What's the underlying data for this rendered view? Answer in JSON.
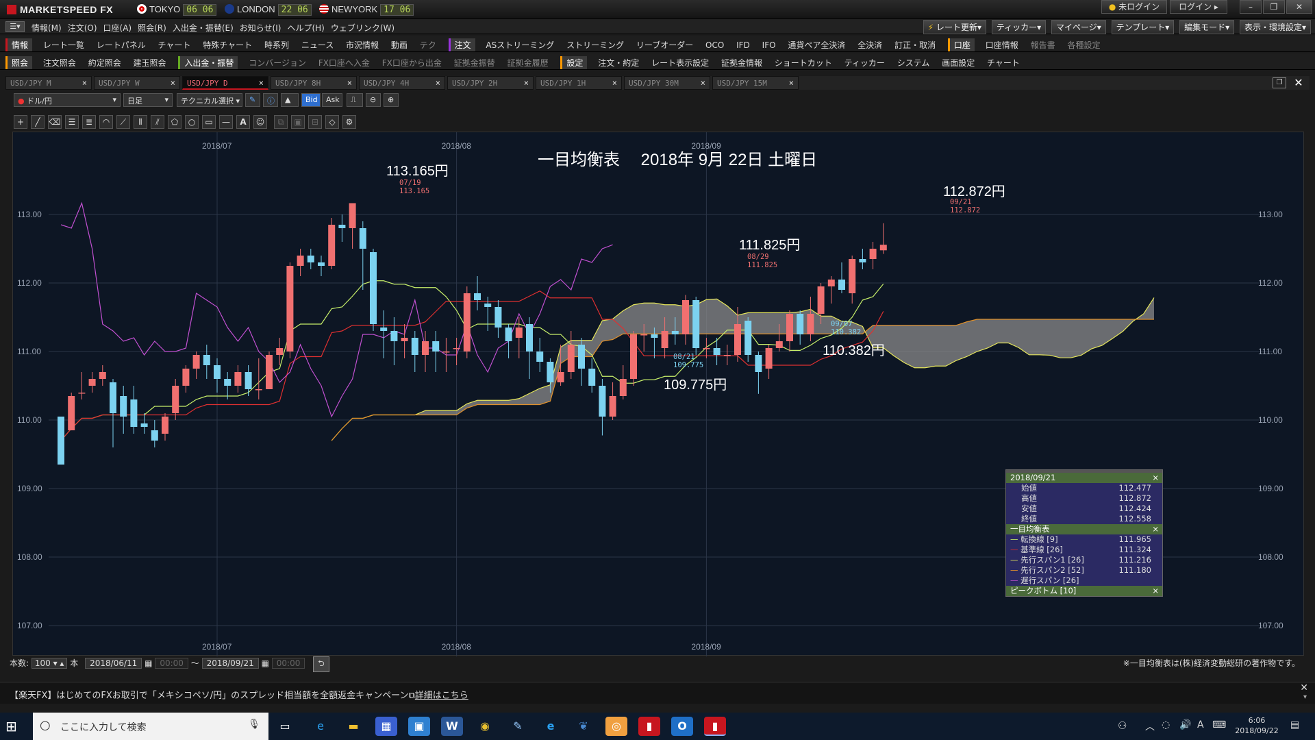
{
  "app": {
    "brand": "MARKETSPEED FX"
  },
  "clocks": [
    {
      "city": "TOKYO",
      "time": "06 06"
    },
    {
      "city": "LONDON",
      "time": "22 06"
    },
    {
      "city": "NEWYORK",
      "time": "17 06"
    }
  ],
  "titlebar_buttons": {
    "status": "未ログイン",
    "login": "ログイン"
  },
  "menu": [
    "情報(M)",
    "注文(O)",
    "口座(A)",
    "照会(R)",
    "入出金・振替(E)",
    "お知らせ(I)",
    "ヘルプ(H)",
    "ウェブリンク(W)"
  ],
  "menu_right": [
    "レート更新",
    "ティッカー",
    "マイページ",
    "テンプレート",
    "編集モード",
    "表示・環境設定"
  ],
  "toolbar1": {
    "info_head": "情報",
    "info_items": [
      "レート一覧",
      "レートパネル",
      "チャート",
      "特殊チャート",
      "時系列",
      "ニュース",
      "市況情報",
      "動画",
      "テク"
    ],
    "order_head": "注文",
    "order_items": [
      "ASストリーミング",
      "ストリーミング",
      "リーブオーダー",
      "OCO",
      "IFD",
      "IFO",
      "通貨ペア全決済",
      "全決済",
      "訂正・取消"
    ],
    "account_head": "口座",
    "account_items": [
      "口座情報",
      "報告書",
      "各種設定"
    ]
  },
  "toolbar2": {
    "inquiry_head": "照会",
    "inquiry_items": [
      "注文照会",
      "約定照会",
      "建玉照会"
    ],
    "deposit_head": "入出金・振替",
    "deposit_items": [
      "コンバージョン",
      "FX口座へ入金",
      "FX口座から出金",
      "証拠金振替",
      "証拠金履歴"
    ],
    "settings_head": "設定",
    "settings_items": [
      "注文・約定",
      "レート表示設定",
      "証拠金情報",
      "ショートカット",
      "ティッカー",
      "システム",
      "画面設定",
      "チャート"
    ]
  },
  "tabs": [
    "USD/JPY M",
    "USD/JPY W",
    "USD/JPY D",
    "USD/JPY 8H",
    "USD/JPY 4H",
    "USD/JPY 2H",
    "USD/JPY 1H",
    "USD/JPY 30M",
    "USD/JPY 15M"
  ],
  "active_tab": 2,
  "chart_controls": {
    "pair": "ドル/円",
    "period": "日足",
    "technical": "テクニカル選択",
    "bid": "Bid",
    "ask": "Ask"
  },
  "chart_title": "一目均衡表　 2018年 9月 22日 土曜日",
  "annotations": {
    "high1_big": "113.165円",
    "high1_date": "07/19",
    "high1_val": "113.165",
    "high2_big": "112.872円",
    "high2_date": "09/21",
    "high2_val": "112.872",
    "mid_big": "111.825円",
    "mid_date": "08/29",
    "mid_val": "111.825",
    "low1_big": "109.775円",
    "low1_date": "08/21",
    "low1_val": "109.775",
    "low2_big": "110.382円",
    "low2_date": "09/07",
    "low2_val": "110.382"
  },
  "info_panel": {
    "date": "2018/09/21",
    "ohlc": [
      {
        "label": "始値",
        "value": "112.477"
      },
      {
        "label": "高値",
        "value": "112.872"
      },
      {
        "label": "安値",
        "value": "112.424"
      },
      {
        "label": "終値",
        "value": "112.558"
      }
    ],
    "ichimoku_head": "一目均衡表",
    "ichimoku": [
      {
        "label": "転換線 [9]",
        "value": "111.965",
        "color": "#c8f06a"
      },
      {
        "label": "基準線 [26]",
        "value": "111.324",
        "color": "#e03030"
      },
      {
        "label": "先行スパン1 [26]",
        "value": "111.216",
        "color": "#e6e65a"
      },
      {
        "label": "先行スパン2 [52]",
        "value": "111.180",
        "color": "#e0902a"
      },
      {
        "label": "遅行スパン [26]",
        "value": "",
        "color": "#c050d0"
      }
    ],
    "peak_head": "ピークボトム [10]"
  },
  "bottom": {
    "count_label": "本数:",
    "count": "100",
    "unit": "本",
    "from": "2018/06/11",
    "from_time": "00:00",
    "tilde": "〜",
    "to": "2018/09/21",
    "to_time": "00:00",
    "copyright": "※一目均衡表は(株)経済変動総研の著作物です。"
  },
  "news": "【楽天FX】はじめてのFXお取引で「メキシコペソ/円」のスプレッド相当額を全額返金キャンペーン",
  "news_link": "詳細はこちら",
  "taskbar": {
    "search_placeholder": "ここに入力して検索",
    "time": "6:06",
    "date": "2018/09/22",
    "ime": "A"
  },
  "colors": {
    "up": "#f07070",
    "down": "#7cd2f0",
    "bg": "#0d1624",
    "accent": "#c7161f"
  },
  "chart_data": {
    "type": "candlestick",
    "ylim": [
      106.8,
      114.2
    ],
    "yticks": [
      107.0,
      108.0,
      109.0,
      110.0,
      111.0,
      112.0,
      113.0
    ],
    "xticks": [
      "2018/07",
      "2018/08",
      "2018/09"
    ],
    "candles": [
      [
        110.05,
        109.35,
        110.05,
        109.35
      ],
      [
        109.85,
        110.35,
        110.4,
        109.85
      ],
      [
        110.4,
        110.4,
        110.7,
        110.3
      ],
      [
        110.5,
        110.6,
        110.7,
        110.4
      ],
      [
        110.6,
        110.7,
        110.8,
        110.5
      ],
      [
        110.55,
        110.1,
        110.6,
        109.6
      ],
      [
        110.35,
        110.05,
        110.5,
        109.8
      ],
      [
        110.3,
        109.9,
        110.5,
        109.8
      ],
      [
        109.95,
        109.9,
        110.1,
        109.8
      ],
      [
        109.85,
        109.7,
        110.0,
        109.6
      ],
      [
        109.8,
        110.05,
        110.1,
        109.7
      ],
      [
        110.1,
        110.5,
        110.6,
        110.0
      ],
      [
        110.5,
        110.75,
        110.8,
        110.4
      ],
      [
        110.75,
        110.95,
        111.0,
        110.6
      ],
      [
        110.95,
        110.8,
        111.1,
        110.6
      ],
      [
        110.8,
        110.6,
        110.9,
        110.4
      ],
      [
        110.6,
        110.5,
        110.7,
        110.3
      ],
      [
        110.5,
        110.7,
        110.8,
        110.4
      ],
      [
        110.7,
        110.45,
        110.8,
        110.35
      ],
      [
        110.45,
        110.45,
        110.9,
        110.3
      ],
      [
        110.45,
        110.95,
        111.0,
        110.45
      ],
      [
        110.95,
        111.05,
        111.2,
        110.8
      ],
      [
        111.0,
        112.25,
        112.3,
        110.9
      ],
      [
        112.25,
        112.4,
        112.5,
        112.1
      ],
      [
        112.4,
        112.3,
        112.5,
        112.2
      ],
      [
        112.3,
        112.25,
        112.4,
        112.1
      ],
      [
        112.25,
        112.85,
        112.95,
        112.2
      ],
      [
        112.85,
        112.8,
        113.0,
        112.6
      ],
      [
        112.8,
        113.165,
        113.165,
        112.5
      ],
      [
        112.8,
        112.5,
        112.9,
        111.9
      ],
      [
        112.45,
        111.4,
        112.5,
        111.3
      ],
      [
        111.35,
        111.3,
        111.6,
        110.9
      ],
      [
        111.3,
        111.15,
        111.5,
        110.8
      ],
      [
        111.15,
        111.2,
        111.4,
        110.9
      ],
      [
        111.2,
        110.95,
        111.3,
        110.7
      ],
      [
        110.95,
        111.15,
        111.3,
        110.7
      ],
      [
        111.15,
        111.0,
        111.3,
        110.7
      ],
      [
        111.0,
        111.0,
        111.2,
        110.7
      ],
      [
        111.05,
        111.05,
        111.2,
        110.8
      ],
      [
        111.0,
        111.85,
        111.95,
        110.9
      ],
      [
        111.85,
        111.75,
        112.1,
        111.6
      ],
      [
        111.7,
        111.65,
        111.8,
        111.3
      ],
      [
        111.65,
        111.35,
        111.75,
        111.2
      ],
      [
        111.35,
        111.15,
        111.4,
        110.9
      ],
      [
        111.2,
        111.35,
        111.5,
        110.9
      ],
      [
        111.4,
        111.0,
        111.5,
        110.6
      ],
      [
        111.0,
        110.85,
        111.2,
        110.7
      ],
      [
        110.85,
        110.55,
        110.9,
        110.4
      ],
      [
        110.55,
        110.7,
        111.1,
        110.5
      ],
      [
        110.7,
        111.1,
        111.3,
        110.6
      ],
      [
        111.1,
        110.75,
        111.2,
        110.5
      ],
      [
        110.75,
        110.5,
        110.9,
        110.4
      ],
      [
        110.5,
        110.05,
        110.6,
        109.775
      ],
      [
        110.05,
        110.35,
        110.55,
        110.0
      ],
      [
        110.35,
        110.6,
        110.8,
        110.3
      ],
      [
        110.6,
        111.25,
        111.3,
        110.5
      ],
      [
        111.25,
        111.25,
        111.4,
        111.0
      ],
      [
        111.25,
        111.2,
        111.35,
        110.9
      ],
      [
        111.05,
        111.3,
        111.5,
        110.9
      ],
      [
        111.3,
        111.25,
        111.5,
        111.1
      ],
      [
        111.25,
        111.75,
        111.825,
        111.1
      ],
      [
        111.75,
        111.05,
        111.8,
        110.95
      ],
      [
        111.05,
        111.05,
        111.2,
        110.9
      ],
      [
        111.05,
        110.95,
        111.2,
        110.8
      ],
      [
        110.95,
        110.95,
        111.1,
        110.8
      ],
      [
        110.95,
        111.4,
        111.65,
        110.85
      ],
      [
        111.45,
        110.95,
        111.5,
        110.85
      ],
      [
        110.95,
        110.7,
        111.0,
        110.382
      ],
      [
        110.75,
        111.05,
        111.1,
        110.6
      ],
      [
        111.05,
        111.15,
        111.4,
        111.0
      ],
      [
        111.15,
        111.55,
        111.6,
        111.0
      ],
      [
        111.55,
        111.25,
        111.6,
        111.1
      ],
      [
        111.25,
        111.55,
        111.8,
        111.15
      ],
      [
        111.55,
        111.95,
        112.0,
        111.4
      ],
      [
        111.95,
        112.05,
        112.1,
        111.7
      ],
      [
        112.05,
        111.9,
        112.3,
        111.85
      ],
      [
        111.85,
        112.35,
        112.4,
        111.7
      ],
      [
        112.35,
        112.3,
        112.5,
        112.2
      ],
      [
        112.35,
        112.5,
        112.6,
        112.2
      ],
      [
        112.477,
        112.558,
        112.872,
        112.424
      ]
    ]
  }
}
